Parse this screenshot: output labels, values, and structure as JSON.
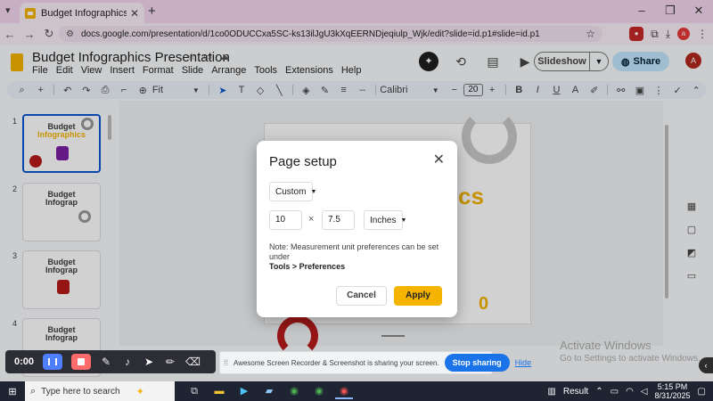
{
  "browser": {
    "tab_title": "Budget Infographics Presentation",
    "url": "docs.google.com/presentation/d/1co0ODUCCxa5SC-ks13ilJgU3kXqEERNDjeqiulp_Wjk/edit?slide=id.p1#slide=id.p1"
  },
  "docs": {
    "title": "Budget Infographics Presentation",
    "menus": [
      "File",
      "Edit",
      "View",
      "Insert",
      "Format",
      "Slide",
      "Arrange",
      "Tools",
      "Extensions",
      "Help"
    ],
    "slideshow_label": "Slideshow",
    "share_label": "Share",
    "avatar_letter": "A"
  },
  "toolbar": {
    "zoom": "Fit",
    "font": "Calibri",
    "font_size": "20"
  },
  "filmstrip": {
    "slides": [
      {
        "num": "1",
        "title_a": "Budget",
        "title_b": "Infographics"
      },
      {
        "num": "2",
        "title_a": "Budget",
        "title_b": "Infograp"
      },
      {
        "num": "3",
        "title_a": "Budget",
        "title_b": "Infograp"
      },
      {
        "num": "4",
        "title_a": "Budget",
        "title_b": "Infograp"
      }
    ]
  },
  "slide": {
    "big_text": "cs",
    "zero": "0"
  },
  "dialog": {
    "title": "Page setup",
    "preset": "Custom",
    "width": "10",
    "times": "×",
    "height": "7.5",
    "unit": "Inches",
    "note": "Note: Measurement unit preferences can be set under",
    "note_bold": "Tools > Preferences",
    "cancel": "Cancel",
    "apply": "Apply"
  },
  "recorder": {
    "time": "0:00",
    "sharing_text": "Awesome Screen Recorder & Screenshot is sharing your screen.",
    "stop_sharing": "Stop sharing",
    "hide": "Hide"
  },
  "watermark": {
    "line1": "Activate Windows",
    "line2": "Go to Settings to activate Windows."
  },
  "taskbar": {
    "search_placeholder": "Type here to search",
    "tray_label": "Result",
    "time": "5:15 PM",
    "date": "8/31/2025"
  },
  "colors": {
    "accent": "#f4b400",
    "share": "#c2e7ff",
    "stop_sharing": "#1a73e8"
  }
}
